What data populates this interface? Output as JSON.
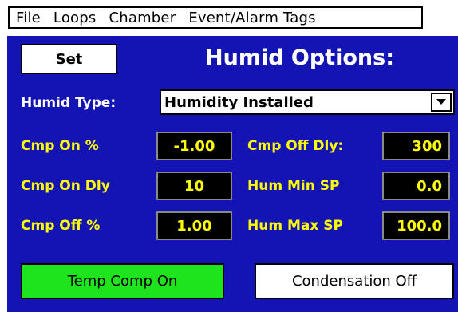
{
  "menu": {
    "items": [
      "File",
      "Loops",
      "Chamber",
      "Event/Alarm Tags"
    ]
  },
  "header": {
    "set_label": "Set",
    "title": "Humid Options:"
  },
  "humid_type": {
    "label": "Humid Type:",
    "value": "Humidity Installed"
  },
  "params_left": [
    {
      "label": "Cmp On %",
      "value": "-1.00"
    },
    {
      "label": "Cmp On Dly",
      "value": "10"
    },
    {
      "label": "Cmp Off %",
      "value": "1.00"
    }
  ],
  "params_right": [
    {
      "label": "Cmp Off Dly:",
      "value": "300"
    },
    {
      "label": "Hum Min SP",
      "value": "0.0"
    },
    {
      "label": "Hum Max SP",
      "value": "100.0"
    }
  ],
  "buttons": {
    "temp_comp": "Temp Comp On",
    "condensation": "Condensation Off"
  },
  "colors": {
    "panel": "#1414b4",
    "value_text": "#ffff00",
    "temp_comp_bg": "#1ee41e"
  },
  "icons": {
    "dropdown": "chevron-down-icon"
  }
}
